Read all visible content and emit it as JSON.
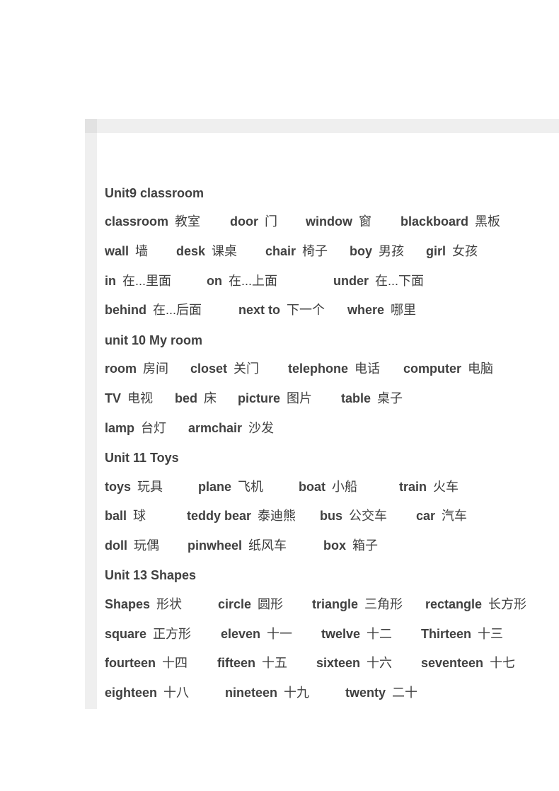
{
  "sections": [
    {
      "heading": "Unit9 classroom",
      "rows": [
        [
          {
            "word": "classroom",
            "meaning": "教室"
          },
          {
            "word": "door",
            "meaning": "门"
          },
          {
            "word": "window",
            "meaning": "窗"
          },
          {
            "word": "blackboard",
            "meaning": "黑板"
          }
        ],
        [
          {
            "word": "wall",
            "meaning": "墙"
          },
          {
            "word": "desk",
            "meaning": "课桌"
          },
          {
            "word": "chair",
            "meaning": "椅子"
          },
          {
            "word": "boy",
            "meaning": "男孩"
          },
          {
            "word": "girl",
            "meaning": "女孩"
          }
        ],
        [
          {
            "word": "in",
            "meaning": "在...里面"
          },
          {
            "word": "on",
            "meaning": "在...上面"
          },
          {
            "word": "under",
            "meaning": "在...下面"
          }
        ],
        [
          {
            "word": "behind",
            "meaning": "在...后面"
          },
          {
            "word": "next to",
            "meaning": "下一个"
          },
          {
            "word": "where",
            "meaning": "哪里"
          }
        ]
      ]
    },
    {
      "heading": "unit 10 My room",
      "rows": [
        [
          {
            "word": "room",
            "meaning": "房间"
          },
          {
            "word": "closet",
            "meaning": "关门"
          },
          {
            "word": "telephone",
            "meaning": "电话"
          },
          {
            "word": "computer",
            "meaning": "电脑"
          }
        ],
        [
          {
            "word": "TV",
            "meaning": "电视"
          },
          {
            "word": "bed",
            "meaning": "床"
          },
          {
            "word": "picture",
            "meaning": "图片"
          },
          {
            "word": "table",
            "meaning": "桌子"
          }
        ],
        [
          {
            "word": "lamp",
            "meaning": "台灯"
          },
          {
            "word": "armchair",
            "meaning": "沙发"
          }
        ]
      ]
    },
    {
      "heading": "Unit 11 Toys",
      "rows": [
        [
          {
            "word": "toys",
            "meaning": "玩具"
          },
          {
            "word": "plane",
            "meaning": "飞机"
          },
          {
            "word": "boat",
            "meaning": "小船"
          },
          {
            "word": "train",
            "meaning": "火车"
          }
        ],
        [
          {
            "word": "ball",
            "meaning": "球"
          },
          {
            "word": "teddy bear",
            "meaning": "泰迪熊"
          },
          {
            "word": "bus",
            "meaning": "公交车"
          },
          {
            "word": "car",
            "meaning": "汽车"
          }
        ],
        [
          {
            "word": "doll",
            "meaning": "玩偶"
          },
          {
            "word": "pinwheel",
            "meaning": "纸风车"
          },
          {
            "word": "box",
            "meaning": "箱子"
          }
        ]
      ]
    },
    {
      "heading": "Unit 13 Shapes",
      "rows": [
        [
          {
            "word": "Shapes",
            "meaning": "形状"
          },
          {
            "word": "circle",
            "meaning": "圆形"
          },
          {
            "word": "triangle",
            "meaning": "三角形"
          },
          {
            "word": "rectangle",
            "meaning": "长方形"
          }
        ],
        [
          {
            "word": "square",
            "meaning": "正方形"
          },
          {
            "word": "eleven",
            "meaning": "十一"
          },
          {
            "word": "twelve",
            "meaning": "十二"
          },
          {
            "word": "Thirteen",
            "meaning": "十三"
          }
        ],
        [
          {
            "word": "fourteen",
            "meaning": "十四"
          },
          {
            "word": "fifteen",
            "meaning": "十五"
          },
          {
            "word": "sixteen",
            "meaning": "十六"
          },
          {
            "word": "seventeen",
            "meaning": "十七"
          }
        ],
        [
          {
            "word": "eighteen",
            "meaning": "十八"
          },
          {
            "word": "nineteen",
            "meaning": "十九"
          },
          {
            "word": "twenty",
            "meaning": "二十"
          }
        ]
      ]
    }
  ]
}
